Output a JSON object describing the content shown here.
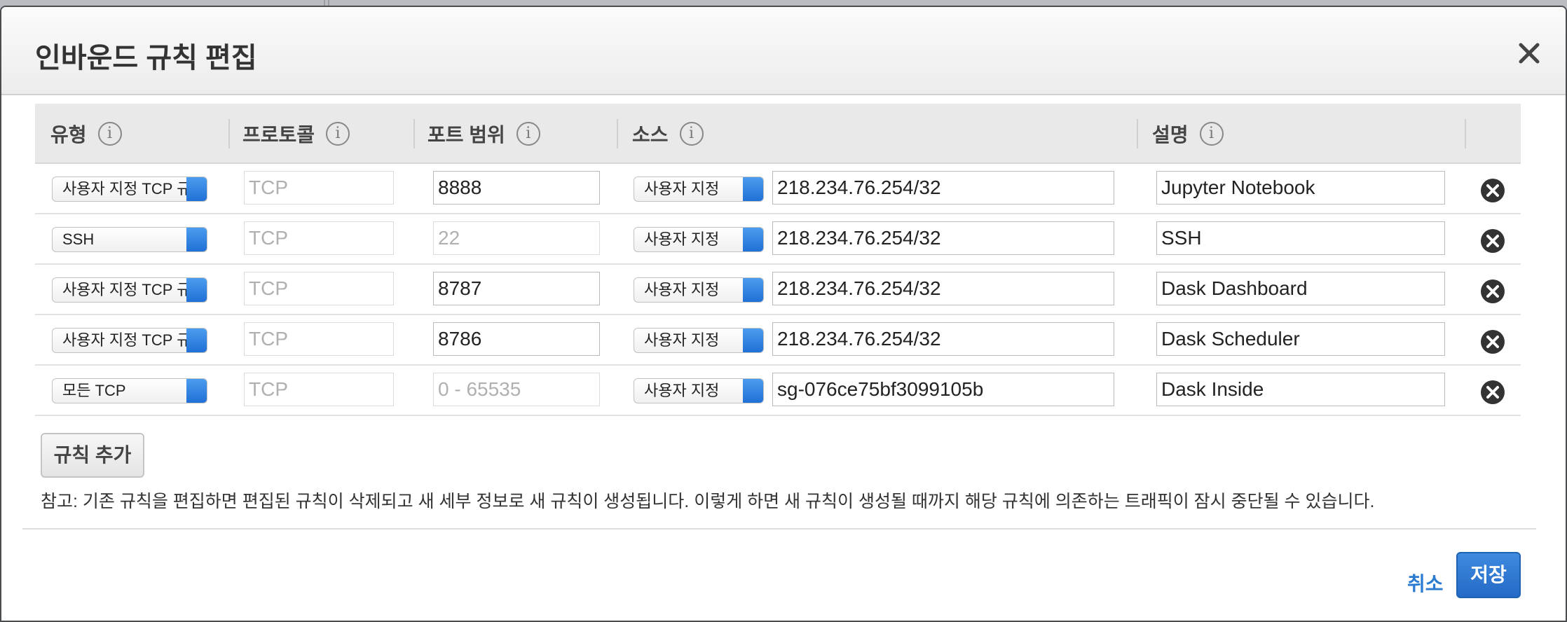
{
  "dialog": {
    "title": "인바운드 규칙 편집",
    "close_label": "×"
  },
  "table": {
    "headers": {
      "type": "유형",
      "protocol": "프로토콜",
      "port_range": "포트 범위",
      "source": "소스",
      "description": "설명"
    },
    "info_glyph": "i",
    "rows": [
      {
        "type": "사용자 지정 TCP 규칙",
        "protocol": "TCP",
        "port": "8888",
        "port_editable": true,
        "source_type": "사용자 지정",
        "source": "218.234.76.254/32",
        "description": "Jupyter Notebook"
      },
      {
        "type": "SSH",
        "protocol": "TCP",
        "port": "22",
        "port_editable": false,
        "source_type": "사용자 지정",
        "source": "218.234.76.254/32",
        "description": "SSH"
      },
      {
        "type": "사용자 지정 TCP 규칙",
        "protocol": "TCP",
        "port": "8787",
        "port_editable": true,
        "source_type": "사용자 지정",
        "source": "218.234.76.254/32",
        "description": "Dask Dashboard"
      },
      {
        "type": "사용자 지정 TCP 규칙",
        "protocol": "TCP",
        "port": "8786",
        "port_editable": true,
        "source_type": "사용자 지정",
        "source": "218.234.76.254/32",
        "description": "Dask Scheduler"
      },
      {
        "type": "모든 TCP",
        "protocol": "TCP",
        "port": "0 - 65535",
        "port_editable": false,
        "source_type": "사용자 지정",
        "source": "sg-076ce75bf3099105b",
        "description": "Dask Inside"
      }
    ]
  },
  "actions": {
    "add_rule": "규칙 추가",
    "cancel": "취소",
    "save": "저장"
  },
  "note": "참고: 기존 규칙을 편집하면 편집된 규칙이 삭제되고 새 세부 정보로 새 규칙이 생성됩니다. 이렇게 하면 새 규칙이 생성될 때까지 해당 규칙에 의존하는 트래픽이 잠시 중단될 수 있습니다.",
  "colors": {
    "accent": "#2a7bd1",
    "primary_button": "#2469c6",
    "select_arrow": "#1f6fd6",
    "header_bg": "#e9e9e9"
  },
  "icons": {
    "close": "close-icon",
    "info": "info-icon",
    "delete": "remove-circle-icon",
    "select_arrows": "updown-chevron-icon"
  }
}
